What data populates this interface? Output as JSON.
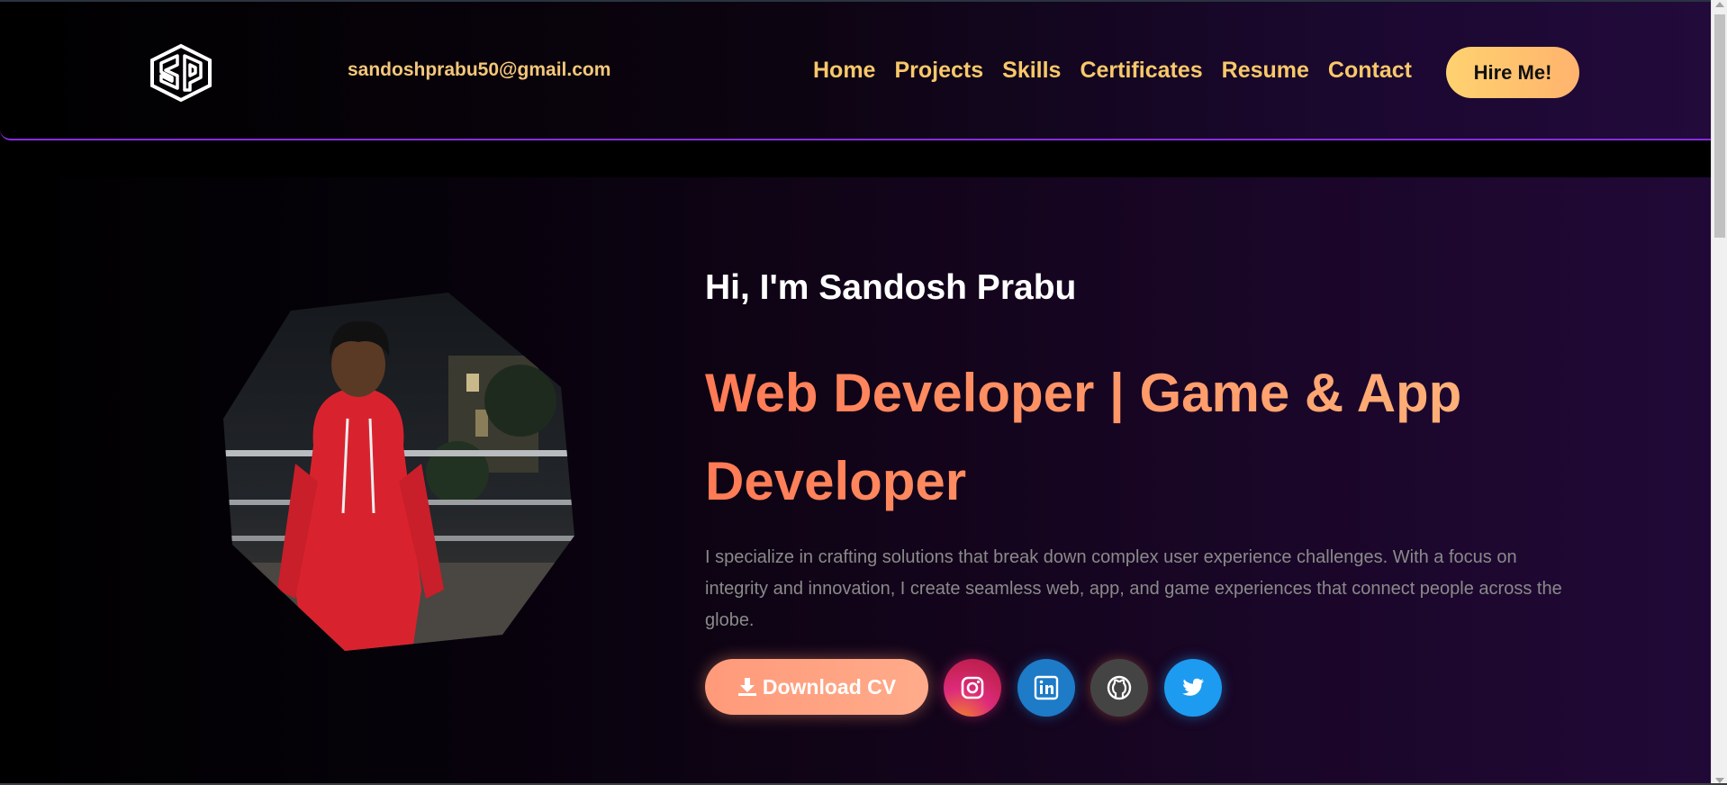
{
  "header": {
    "logo_alt": "SP",
    "email": "sandoshprabu50@gmail.com",
    "nav": [
      "Home",
      "Projects",
      "Skills",
      "Certificates",
      "Resume",
      "Contact"
    ],
    "hire_label": "Hire Me!"
  },
  "hero": {
    "greeting": "Hi, I'm Sandosh Prabu",
    "role": "Web Developer | Game & App Developer",
    "bio": "I specialize in crafting solutions that break down complex user experience challenges. With a focus on integrity and innovation, I create seamless web, app, and game experiences that connect people across the globe.",
    "cv_label": "Download CV",
    "socials": [
      "instagram-icon",
      "linkedin-icon",
      "github-icon",
      "twitter-icon"
    ]
  },
  "colors": {
    "accent": "#f8c86a",
    "role_gradient_start": "#ff7a55",
    "role_gradient_end": "#ffb47a",
    "header_border": "#8a2be2"
  }
}
